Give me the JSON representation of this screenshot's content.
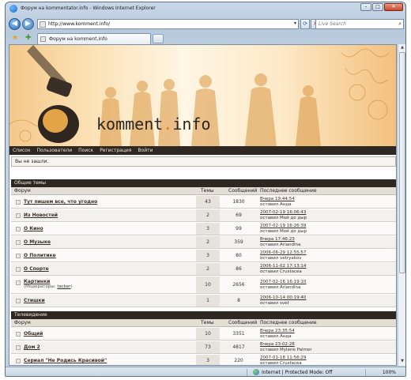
{
  "window": {
    "title": "Форум на kommentator.info - Windows Internet Explorer",
    "minimize": "–",
    "maximize": "□",
    "close": "✕"
  },
  "toolbar": {
    "url": "http://www.komment.info/",
    "search_placeholder": "Live Search",
    "tab_label": "Форум на komment.info"
  },
  "site": {
    "logo_main": "komment",
    "logo_dot": ".",
    "logo_tld": "info",
    "nav": [
      "Список",
      "Пользователи",
      "Поиск",
      "Регистрация",
      "Войти"
    ],
    "notice": "Вы не зашли."
  },
  "columns": {
    "forum": "Форум",
    "topics": "Темы",
    "posts": "Сообщений",
    "last": "Последнее сообщение"
  },
  "sections": [
    {
      "title": "Общие темы",
      "forums": [
        {
          "name": "Тут пишем все, что угодно",
          "topics": "43",
          "posts": "1830",
          "last_date": "Вчера 19:44:54",
          "last_by": "оставил Анда"
        },
        {
          "name": "Из Новостей",
          "topics": "2",
          "posts": "69",
          "last_date": "2007-02-19 16:06:43",
          "last_by": "оставил Мой до дыр"
        },
        {
          "name": "О Кино",
          "topics": "3",
          "posts": "99",
          "last_date": "2007-02-19 16:26:39",
          "last_by": "оставил Мой до дыр"
        },
        {
          "name": "О Музыке",
          "topics": "2",
          "posts": "359",
          "last_date": "Вчера 17:46:23",
          "last_by": "оставил Arlandina"
        },
        {
          "name": "О Политике",
          "topics": "3",
          "posts": "80",
          "last_date": "2006-06-29 12:55:57",
          "last_by": "оставил vetryakov"
        },
        {
          "name": "О Спорте",
          "topics": "2",
          "posts": "86",
          "last_date": "2006-11-02 17:13:14",
          "last_by": "оставил Crustacea"
        },
        {
          "name": "Картинки",
          "moderators_label": "(Модераторы:",
          "moderator": "tacker",
          "moderators_close": ")",
          "topics": "10",
          "posts": "2656",
          "last_date": "2007-02-16 16:19:10",
          "last_by": "оставил Arlandina"
        },
        {
          "name": "Стишки",
          "topics": "1",
          "posts": "8",
          "last_date": "2006-10-14 00:19:40",
          "last_by": "оставил svet"
        }
      ]
    },
    {
      "title": "Телевидение",
      "forums": [
        {
          "name": "Общий",
          "topics": "10",
          "posts": "3351",
          "last_date": "Вчера 23:35:54",
          "last_by": "оставил Анда"
        },
        {
          "name": "Дом 2",
          "topics": "73",
          "posts": "4817",
          "last_date": "Вчера 23:02:28",
          "last_by": "оставил Mylene Palmer"
        },
        {
          "name": "Сериал \"Не Родись Красивой\"",
          "topics": "3",
          "posts": "220",
          "last_date": "2007-01-18 11:56:29",
          "last_by": "оставил Crustacea"
        }
      ]
    }
  ],
  "status": {
    "zone": "Internet | Protected Mode: Off",
    "zoom": "100%"
  }
}
